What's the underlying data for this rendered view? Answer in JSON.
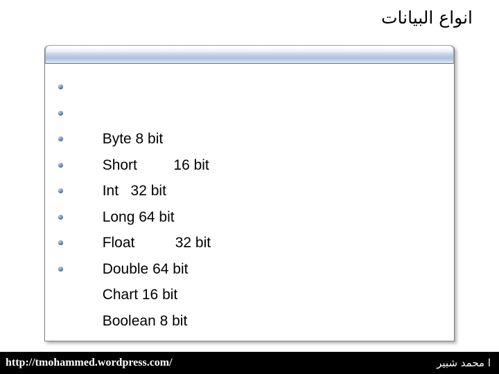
{
  "slide": {
    "title": "انواع البيانات",
    "bullets": [
      {
        "label": "Byte 8 bit"
      },
      {
        "label": "Short         16 bit"
      },
      {
        "label": "Int   32 bit"
      },
      {
        "label": "Long 64 bit"
      },
      {
        "label": "Float          32 bit"
      },
      {
        "label": "Double 64 bit"
      },
      {
        "label": "Chart 16 bit"
      },
      {
        "label": "Boolean 8 bit"
      }
    ]
  },
  "footer": {
    "url": "http://tmohammed.wordpress.com/",
    "author": "ا محمد شبير"
  },
  "colors": {
    "panel_header_light": "#dce6f1",
    "panel_header_mid": "#b8cce4",
    "panel_border": "#7b7b7b",
    "bullet": "#4e719c",
    "footer_background": "#000000",
    "footer_text": "#ffffff",
    "body_text": "#000000"
  }
}
